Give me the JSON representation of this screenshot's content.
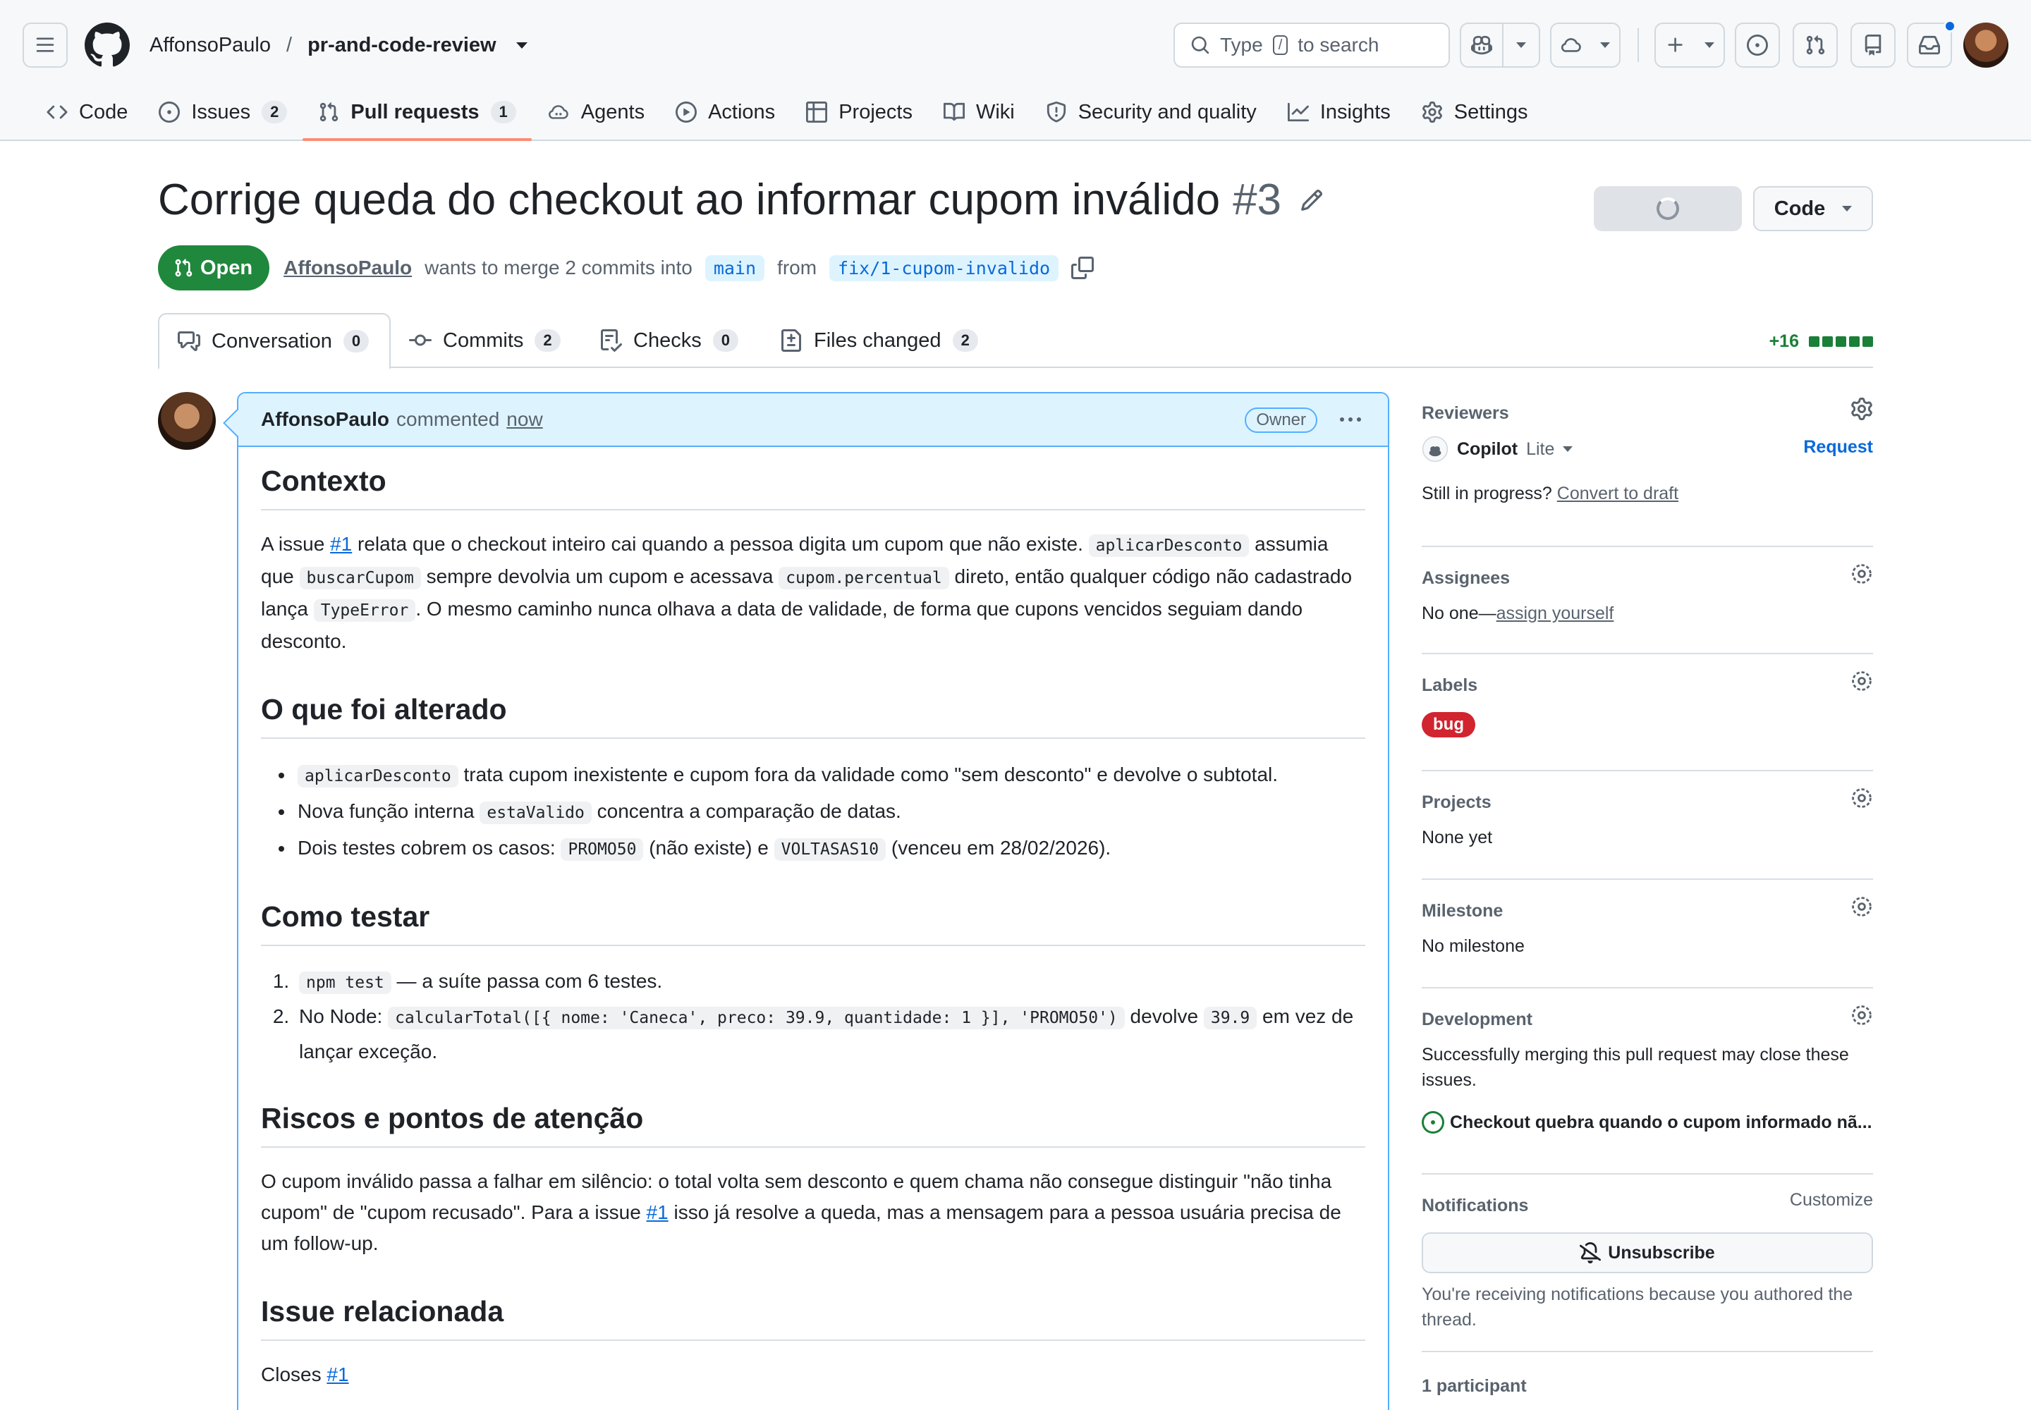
{
  "header": {
    "owner": "AffonsoPaulo",
    "separator": "/",
    "repo": "pr-and-code-review",
    "search_prefix": "Type",
    "search_key": "/",
    "search_suffix": "to search"
  },
  "repo_nav": [
    {
      "label": "Code",
      "icon": "code-icon"
    },
    {
      "label": "Issues",
      "count": "2",
      "icon": "issue-opened-icon"
    },
    {
      "label": "Pull requests",
      "count": "1",
      "icon": "git-pull-request-icon",
      "active": true
    },
    {
      "label": "Agents",
      "icon": "agent-icon"
    },
    {
      "label": "Actions",
      "icon": "play-icon"
    },
    {
      "label": "Projects",
      "icon": "table-icon"
    },
    {
      "label": "Wiki",
      "icon": "book-icon"
    },
    {
      "label": "Security and quality",
      "icon": "shield-icon"
    },
    {
      "label": "Insights",
      "icon": "graph-icon"
    },
    {
      "label": "Settings",
      "icon": "gear-icon"
    }
  ],
  "pr": {
    "title": "Corrige queda do checkout ao informar cupom inválido",
    "number": "#3",
    "state": "Open",
    "author": "AffonsoPaulo",
    "merge_text": "wants to merge 2 commits into",
    "base_branch": "main",
    "from_text": "from",
    "head_branch": "fix/1-cupom-invalido",
    "code_button": "Code"
  },
  "pr_tabs": [
    {
      "label": "Conversation",
      "count": "0"
    },
    {
      "label": "Commits",
      "count": "2"
    },
    {
      "label": "Checks",
      "count": "0"
    },
    {
      "label": "Files changed",
      "count": "2"
    }
  ],
  "diffstat": {
    "additions": "+16"
  },
  "comment": {
    "author": "AffonsoPaulo",
    "action": "commented",
    "time": "now",
    "role": "Owner",
    "sections": {
      "contexto": {
        "heading": "Contexto",
        "t1": "A issue ",
        "link1": "#1",
        "t2": " relata que o checkout inteiro cai quando a pessoa digita um cupom que não existe. ",
        "c1": "aplicarDesconto",
        "t3": " assumia que ",
        "c2": "buscarCupom",
        "t4": " sempre devolvia um cupom e acessava ",
        "c3": "cupom.percentual",
        "t5": " direto, então qualquer código não cadastrado lança ",
        "c4": "TypeError",
        "t6": ". O mesmo caminho nunca olhava a data de validade, de forma que cupons vencidos seguiam dando desconto."
      },
      "alterado": {
        "heading": "O que foi alterado",
        "i1_code": "aplicarDesconto",
        "i1_text": " trata cupom inexistente e cupom fora da validade como \"sem desconto\" e devolve o subtotal.",
        "i2_text": "Nova função interna ",
        "i2_code": "estaValido",
        "i2_text2": " concentra a comparação de datas.",
        "i3_text": "Dois testes cobrem os casos: ",
        "i3_code1": "PROMO50",
        "i3_text2": " (não existe) e ",
        "i3_code2": "VOLTASAS10",
        "i3_text3": " (venceu em 28/02/2026)."
      },
      "testar": {
        "heading": "Como testar",
        "s1_code": "npm test",
        "s1_text": " — a suíte passa com 6 testes.",
        "s2_text": "No Node: ",
        "s2_code": "calcularTotal([{ nome: 'Caneca', preco: 39.9, quantidade: 1 }], 'PROMO50')",
        "s2_text2": " devolve ",
        "s2_code2": "39.9",
        "s2_text3": " em vez de lançar exceção."
      },
      "riscos": {
        "heading": "Riscos e pontos de atenção",
        "t1": "O cupom inválido passa a falhar em silêncio: o total volta sem desconto e quem chama não consegue distinguir \"não tinha cupom\" de \"cupom recusado\". Para a issue ",
        "link": "#1",
        "t2": " isso já resolve a queda, mas a mensagem para a pessoa usuária precisa de um follow-up."
      },
      "issue": {
        "heading": "Issue relacionada",
        "t1": "Closes ",
        "link": "#1"
      }
    }
  },
  "sidebar": {
    "reviewers": {
      "title": "Reviewers",
      "reviewer": "Copilot",
      "tier": "Lite",
      "request": "Request",
      "draft_prompt": "Still in progress?",
      "draft_link": "Convert to draft"
    },
    "assignees": {
      "title": "Assignees",
      "none": "No one—",
      "link": "assign yourself"
    },
    "labels": {
      "title": "Labels",
      "items": [
        "bug"
      ],
      "colors": {
        "bug": "#d1242f"
      }
    },
    "projects": {
      "title": "Projects",
      "value": "None yet"
    },
    "milestone": {
      "title": "Milestone",
      "value": "No milestone"
    },
    "development": {
      "title": "Development",
      "text": "Successfully merging this pull request may close these issues.",
      "issue": "Checkout quebra quando o cupom informado nã..."
    },
    "notifications": {
      "title": "Notifications",
      "customize": "Customize",
      "button": "Unsubscribe",
      "reason": "You're receiving notifications because you authored the thread."
    },
    "participants": {
      "title": "1 participant"
    }
  },
  "colors": {
    "accent": "#0969da",
    "open_green": "#1f883d",
    "tab_underline": "#fd8c73",
    "comment_border": "#54aeff",
    "comment_header": "#ddf4ff"
  }
}
